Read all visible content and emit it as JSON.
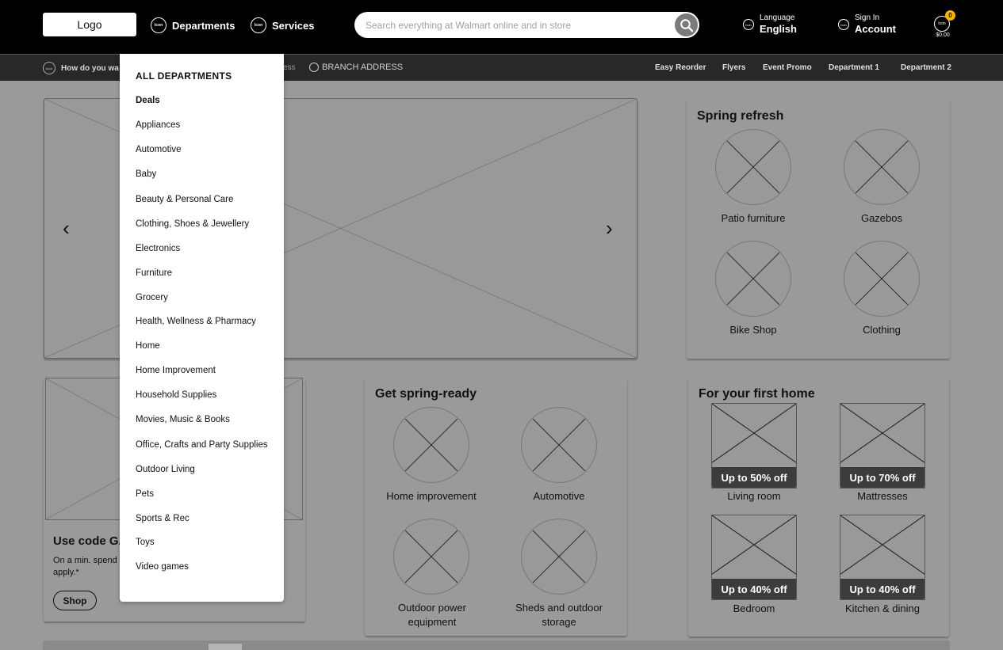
{
  "header": {
    "logo": "Logo",
    "icon_text": "Icon",
    "departments_label": "Departments",
    "services_label": "Services",
    "search_placeholder": "Search everything at Walmart online and in store",
    "language_small": "Language",
    "language_big": "English",
    "signin_small": "Sign In",
    "signin_big": "Account",
    "cart_count": "0",
    "cart_total": "$0.00"
  },
  "subnav": {
    "left_text": "How do you wa",
    "fragment_text": "ess",
    "branch": "BRANCH ADDRESS",
    "links": [
      "Easy Reorder",
      "Flyers",
      "Event Promo",
      "Department 1",
      "Department 2"
    ]
  },
  "dropdown": {
    "heading": "ALL DEPARTMENTS",
    "items": [
      "Deals",
      "Appliances",
      "Automotive",
      "Baby",
      "Beauty & Personal Care",
      "Clothing, Shoes & Jewellery",
      "Electronics",
      "Furniture",
      "Grocery",
      "Health, Wellness & Pharmacy",
      "Home",
      "Home Improvement",
      "Household Supplies",
      "Movies, Music & Books",
      "Office, Crafts and Party Supplies",
      "Outdoor Living",
      "Pets",
      "Sports & Rec",
      "Toys",
      "Video games"
    ]
  },
  "hero": {
    "prev": "‹",
    "next": "›"
  },
  "spring_refresh": {
    "title": "Spring refresh",
    "items": [
      "Patio furniture",
      "Gazebos",
      "Bike Shop",
      "Clothing"
    ]
  },
  "promo": {
    "title": "Use code GA",
    "desc_line1": "On a min. spend",
    "desc_line2": "apply.*",
    "button": "Shop"
  },
  "spring_ready": {
    "title": "Get spring-ready",
    "items": [
      "Home improvement",
      "Automotive",
      "Outdoor power equipment",
      "Sheds and outdoor storage"
    ]
  },
  "first_home": {
    "title": "For your first home",
    "items": [
      {
        "badge": "Up to 50% off",
        "label": "Living room"
      },
      {
        "badge": "Up to 70% off",
        "label": "Mattresses"
      },
      {
        "badge": "Up to 40% off",
        "label": "Bedroom"
      },
      {
        "badge": "Up to 40% off",
        "label": "Kitchen & dining"
      }
    ]
  }
}
